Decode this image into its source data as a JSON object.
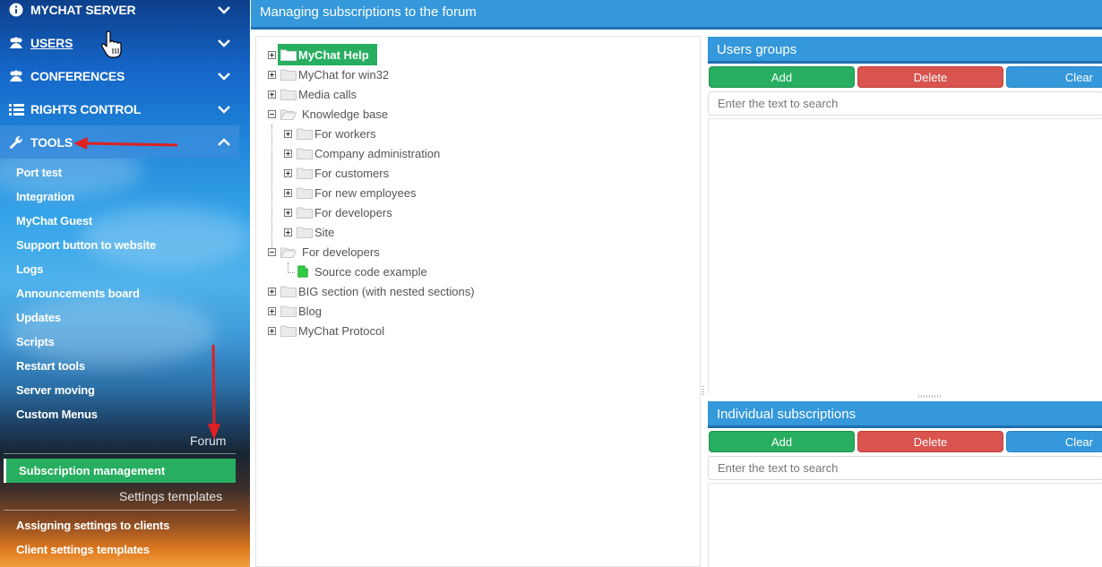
{
  "sidebar": {
    "menus": [
      {
        "label": "MYCHAT SERVER",
        "icon": "info-icon",
        "expanded": false
      },
      {
        "label": "USERS",
        "icon": "users-icon",
        "expanded": false
      },
      {
        "label": "CONFERENCES",
        "icon": "conferences-icon",
        "expanded": false
      },
      {
        "label": "RIGHTS CONTROL",
        "icon": "list-icon",
        "expanded": false
      },
      {
        "label": "TOOLS",
        "icon": "wrench-icon",
        "expanded": true
      }
    ],
    "tools_items": [
      "Port test",
      "Integration",
      "MyChat Guest",
      "Support button to website",
      "Logs",
      "Announcements board",
      "Updates",
      "Scripts",
      "Restart tools",
      "Server moving",
      "Custom Menus"
    ],
    "forum_section": "Forum",
    "forum_items": [
      "Subscription management"
    ],
    "settings_section": "Settings templates",
    "settings_items": [
      "Assigning settings to clients",
      "Client settings templates"
    ]
  },
  "main": {
    "title": "Managing subscriptions to the forum",
    "tree": [
      {
        "label": "MyChat Help",
        "selected": true
      },
      {
        "label": "MyChat for win32"
      },
      {
        "label": "Media calls"
      },
      {
        "label": "Knowledge base",
        "expanded": true
      },
      {
        "label": "For workers"
      },
      {
        "label": "Company administration"
      },
      {
        "label": "For customers"
      },
      {
        "label": "For new employees"
      },
      {
        "label": "For developers"
      },
      {
        "label": "Site"
      },
      {
        "label": "For developers",
        "expanded": true
      },
      {
        "label": "Source code example"
      },
      {
        "label": "BIG section (with nested sections)"
      },
      {
        "label": "Blog"
      },
      {
        "label": "MyChat Protocol"
      }
    ]
  },
  "users_groups": {
    "title": "Users groups",
    "add_label": "Add",
    "delete_label": "Delete",
    "clear_label": "Clear",
    "search_placeholder": "Enter the text to search"
  },
  "individual": {
    "title": "Individual subscriptions",
    "add_label": "Add",
    "delete_label": "Delete",
    "clear_label": "Clear",
    "search_placeholder": "Enter the text to search"
  },
  "colors": {
    "accent": "#3498db",
    "green": "#27ae60",
    "red": "#d9534f",
    "annotation": "#e02020"
  }
}
